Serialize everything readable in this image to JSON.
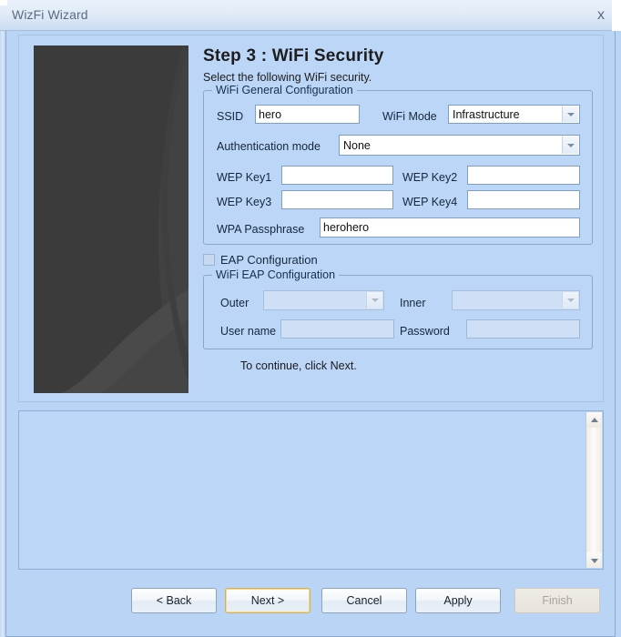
{
  "window": {
    "title": "WizFi Wizard",
    "close_label": "x"
  },
  "page": {
    "step_title": "Step 3 : WiFi Security",
    "subtitle": "Select the following WiFi security.",
    "continue_text": "To continue, click Next."
  },
  "general_group": {
    "title": "WiFi General Configuration",
    "ssid_label": "SSID",
    "ssid_value": "hero",
    "wifi_mode_label": "WiFi Mode",
    "wifi_mode_value": "Infrastructure",
    "auth_mode_label": "Authentication mode",
    "auth_mode_value": "None",
    "wep_key1_label": "WEP Key1",
    "wep_key1_value": "",
    "wep_key2_label": "WEP Key2",
    "wep_key2_value": "",
    "wep_key3_label": "WEP Key3",
    "wep_key3_value": "",
    "wep_key4_label": "WEP Key4",
    "wep_key4_value": "",
    "wpa_passphrase_label": "WPA Passphrase",
    "wpa_passphrase_value": "herohero"
  },
  "eap": {
    "checkbox_label": "EAP Configuration",
    "checked": false,
    "group_title": "WiFi EAP Configuration",
    "outer_label": "Outer",
    "outer_value": "",
    "inner_label": "Inner",
    "inner_value": "",
    "username_label": "User name",
    "username_value": "",
    "password_label": "Password",
    "password_value": ""
  },
  "log": {
    "content": ""
  },
  "buttons": {
    "back": "< Back",
    "next": "Next >",
    "cancel": "Cancel",
    "apply": "Apply",
    "finish": "Finish"
  }
}
